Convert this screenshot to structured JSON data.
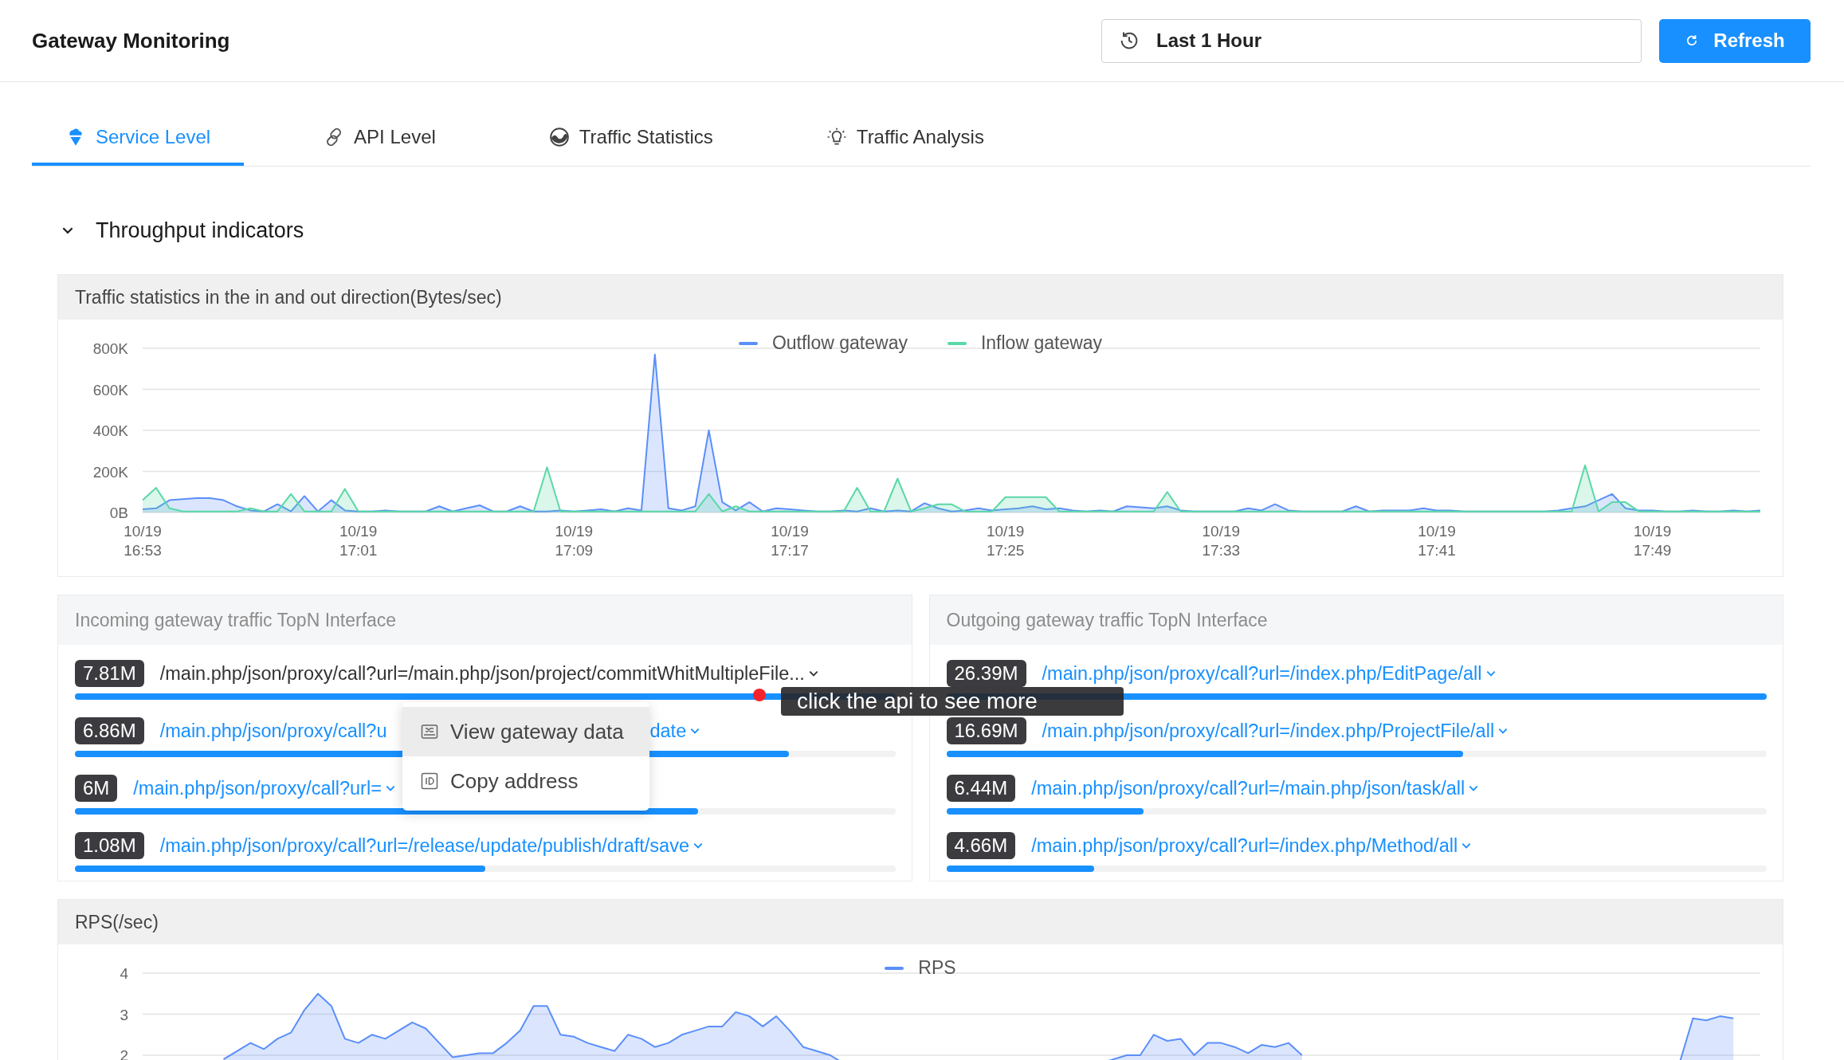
{
  "header": {
    "title": "Gateway Monitoring",
    "time_range": "Last 1 Hour",
    "refresh_button": "Refresh"
  },
  "tabs": [
    {
      "label": "Service Level",
      "selected": true
    },
    {
      "label": "API Level",
      "selected": false
    },
    {
      "label": "Traffic Statistics",
      "selected": false
    },
    {
      "label": "Traffic Analysis",
      "selected": false
    }
  ],
  "section": {
    "title": "Throughput indicators",
    "expanded": true
  },
  "traffic_chart": {
    "title": "Traffic statistics in the in and out direction(Bytes/sec)",
    "chart_data": {
      "type": "area",
      "grid": true,
      "legend": "top",
      "ylim": [
        0,
        800
      ],
      "yticks": [
        {
          "value": 0,
          "label": "0B"
        },
        {
          "value": 200,
          "label": "200K"
        },
        {
          "value": 400,
          "label": "400K"
        },
        {
          "value": 600,
          "label": "600K"
        },
        {
          "value": 800,
          "label": "800K"
        }
      ],
      "categories": [
        "10/19 16:53",
        null,
        null,
        null,
        null,
        null,
        null,
        null,
        null,
        null,
        null,
        null,
        null,
        null,
        null,
        null,
        "10/19 17:01",
        null,
        null,
        null,
        null,
        null,
        null,
        null,
        null,
        null,
        null,
        null,
        null,
        null,
        null,
        null,
        "10/19 17:09",
        null,
        null,
        null,
        null,
        null,
        null,
        null,
        null,
        null,
        null,
        null,
        null,
        null,
        null,
        null,
        "10/19 17:17",
        null,
        null,
        null,
        null,
        null,
        null,
        null,
        null,
        null,
        null,
        null,
        null,
        null,
        null,
        null,
        "10/19 17:25",
        null,
        null,
        null,
        null,
        null,
        null,
        null,
        null,
        null,
        null,
        null,
        null,
        null,
        null,
        null,
        "10/19 17:33",
        null,
        null,
        null,
        null,
        null,
        null,
        null,
        null,
        null,
        null,
        null,
        null,
        null,
        null,
        null,
        "10/19 17:41",
        null,
        null,
        null,
        null,
        null,
        null,
        null,
        null,
        null,
        null,
        null,
        null,
        null,
        null,
        null,
        "10/19 17:49",
        null,
        null,
        null,
        null,
        null,
        null,
        null,
        null
      ],
      "series": [
        {
          "name": "Outflow gateway",
          "color": "#5b8ff9",
          "values": [
            15,
            20,
            60,
            65,
            70,
            70,
            60,
            30,
            10,
            5,
            40,
            5,
            80,
            5,
            60,
            10,
            5,
            5,
            10,
            5,
            5,
            5,
            30,
            5,
            20,
            35,
            5,
            5,
            30,
            5,
            5,
            10,
            5,
            10,
            15,
            5,
            20,
            10,
            770,
            20,
            10,
            30,
            400,
            50,
            10,
            50,
            5,
            20,
            15,
            10,
            5,
            5,
            10,
            5,
            20,
            5,
            10,
            5,
            45,
            20,
            5,
            10,
            20,
            10,
            15,
            20,
            30,
            15,
            20,
            10,
            5,
            10,
            5,
            30,
            25,
            20,
            30,
            10,
            5,
            5,
            5,
            5,
            20,
            10,
            40,
            10,
            5,
            5,
            5,
            5,
            30,
            5,
            10,
            10,
            10,
            20,
            10,
            10,
            5,
            5,
            5,
            5,
            5,
            5,
            5,
            10,
            20,
            30,
            60,
            90,
            20,
            10,
            10,
            5,
            5,
            10,
            5,
            5,
            10,
            5,
            10
          ]
        },
        {
          "name": "Inflow gateway",
          "color": "#5ad8a6",
          "values": [
            60,
            120,
            20,
            5,
            5,
            5,
            5,
            5,
            20,
            5,
            5,
            90,
            5,
            5,
            5,
            115,
            5,
            5,
            5,
            5,
            5,
            5,
            5,
            5,
            5,
            5,
            5,
            5,
            5,
            5,
            220,
            5,
            5,
            5,
            5,
            5,
            5,
            5,
            5,
            5,
            5,
            5,
            90,
            5,
            30,
            5,
            5,
            5,
            5,
            5,
            5,
            5,
            5,
            120,
            5,
            5,
            165,
            5,
            20,
            40,
            40,
            5,
            5,
            5,
            75,
            75,
            75,
            75,
            5,
            5,
            5,
            5,
            5,
            5,
            5,
            5,
            100,
            5,
            5,
            5,
            5,
            5,
            5,
            5,
            5,
            5,
            5,
            5,
            5,
            5,
            5,
            5,
            5,
            5,
            5,
            5,
            5,
            5,
            5,
            5,
            5,
            5,
            5,
            5,
            5,
            5,
            5,
            230,
            5,
            50,
            50,
            5,
            5,
            5,
            5,
            5,
            5,
            5,
            5,
            5,
            5
          ]
        }
      ]
    }
  },
  "incoming_topn": {
    "title": "Incoming gateway traffic TopN Interface",
    "items": [
      {
        "value": "7.81M",
        "path": "/main.php/json/proxy/call?url=/main.php/json/project/commitWhitMultipleFile...",
        "hovered": true,
        "level": 1.0
      },
      {
        "value": "6.86M",
        "path": "/main.php/json/proxy/call?u",
        "path_tail": "date",
        "hovered": false,
        "level": 0.87
      },
      {
        "value": "6M",
        "path": "/main.php/json/proxy/call?url=",
        "hovered": false,
        "level": 0.76
      },
      {
        "value": "1.08M",
        "path": "/main.php/json/proxy/call?url=/release/update/publish/draft/save",
        "hovered": false,
        "level": 0.5
      }
    ]
  },
  "outgoing_topn": {
    "title": "Outgoing gateway traffic TopN Interface",
    "items": [
      {
        "value": "26.39M",
        "path": "/main.php/json/proxy/call?url=/index.php/EditPage/all",
        "hovered": false,
        "level": 1.0
      },
      {
        "value": "16.69M",
        "path": "/main.php/json/proxy/call?url=/index.php/ProjectFile/all",
        "hovered": false,
        "level": 0.63
      },
      {
        "value": "6.44M",
        "path": "/main.php/json/proxy/call?url=/main.php/json/task/all",
        "hovered": false,
        "level": 0.24
      },
      {
        "value": "4.66M",
        "path": "/main.php/json/proxy/call?url=/index.php/Method/all",
        "hovered": false,
        "level": 0.18
      }
    ]
  },
  "rps_chart": {
    "title": "RPS(/sec)",
    "chart_data": {
      "type": "area",
      "grid": true,
      "legend": "top",
      "ylim": [
        0,
        4
      ],
      "yticks": [
        2,
        3,
        4
      ],
      "categories": [
        null,
        null,
        null,
        null,
        null,
        null,
        null,
        null,
        null,
        null,
        null,
        null,
        null,
        null,
        null,
        null,
        null,
        null,
        null,
        null,
        null,
        null,
        null,
        null,
        null,
        null,
        null,
        null,
        null,
        null,
        null,
        null,
        null,
        null,
        null,
        null,
        null,
        null,
        null,
        null,
        null,
        null,
        null,
        null,
        null,
        null,
        null,
        null,
        null,
        null,
        null,
        null,
        null,
        null,
        null,
        null,
        null,
        null,
        null,
        null,
        null,
        null,
        null,
        null,
        null,
        null,
        null,
        null,
        null,
        null,
        null,
        null,
        null,
        null,
        null,
        null,
        null,
        null,
        null,
        null,
        null,
        null,
        null,
        null,
        null,
        null,
        null,
        null,
        null,
        null,
        null,
        null,
        null,
        null,
        null,
        null,
        null,
        null,
        null,
        null,
        null,
        null,
        null,
        null,
        null,
        null,
        null,
        null,
        null,
        null,
        null,
        null,
        null,
        null,
        null,
        null,
        null,
        null,
        null,
        null,
        null
      ],
      "series": [
        {
          "name": "RPS",
          "color": "#5b8ff9",
          "values": [
            null,
            null,
            null,
            null,
            null,
            null,
            1.9,
            2.1,
            2.3,
            2.15,
            2.4,
            2.55,
            3.1,
            3.5,
            3.2,
            2.4,
            2.3,
            2.5,
            2.4,
            2.6,
            2.8,
            2.65,
            2.3,
            1.95,
            2.0,
            2.05,
            2.05,
            2.3,
            2.6,
            3.2,
            3.2,
            2.5,
            2.45,
            2.3,
            2.2,
            2.1,
            2.5,
            2.4,
            2.2,
            2.3,
            2.5,
            2.6,
            2.7,
            2.7,
            3.05,
            2.95,
            2.7,
            2.95,
            2.6,
            2.2,
            2.1,
            2.0,
            1.8,
            null,
            null,
            null,
            null,
            null,
            null,
            null,
            null,
            null,
            null,
            null,
            null,
            null,
            null,
            null,
            null,
            null,
            null,
            1.8,
            1.9,
            2.0,
            2.0,
            2.5,
            2.35,
            2.4,
            2.0,
            2.3,
            2.3,
            2.2,
            2.05,
            2.25,
            2.2,
            2.3,
            2.0,
            null,
            null,
            null,
            null,
            null,
            null,
            null,
            null,
            null,
            null,
            null,
            null,
            null,
            null,
            null,
            null,
            null,
            null,
            null,
            null,
            null,
            null,
            null,
            null,
            null,
            null,
            null,
            1.8,
            2.9,
            2.85,
            2.95,
            2.9,
            null,
            null
          ]
        }
      ]
    }
  },
  "context_menu": {
    "items": [
      {
        "label": "View gateway data",
        "hovered": true
      },
      {
        "label": "Copy address",
        "hovered": false
      }
    ]
  },
  "tooltip": {
    "text": "click the api to see more"
  }
}
